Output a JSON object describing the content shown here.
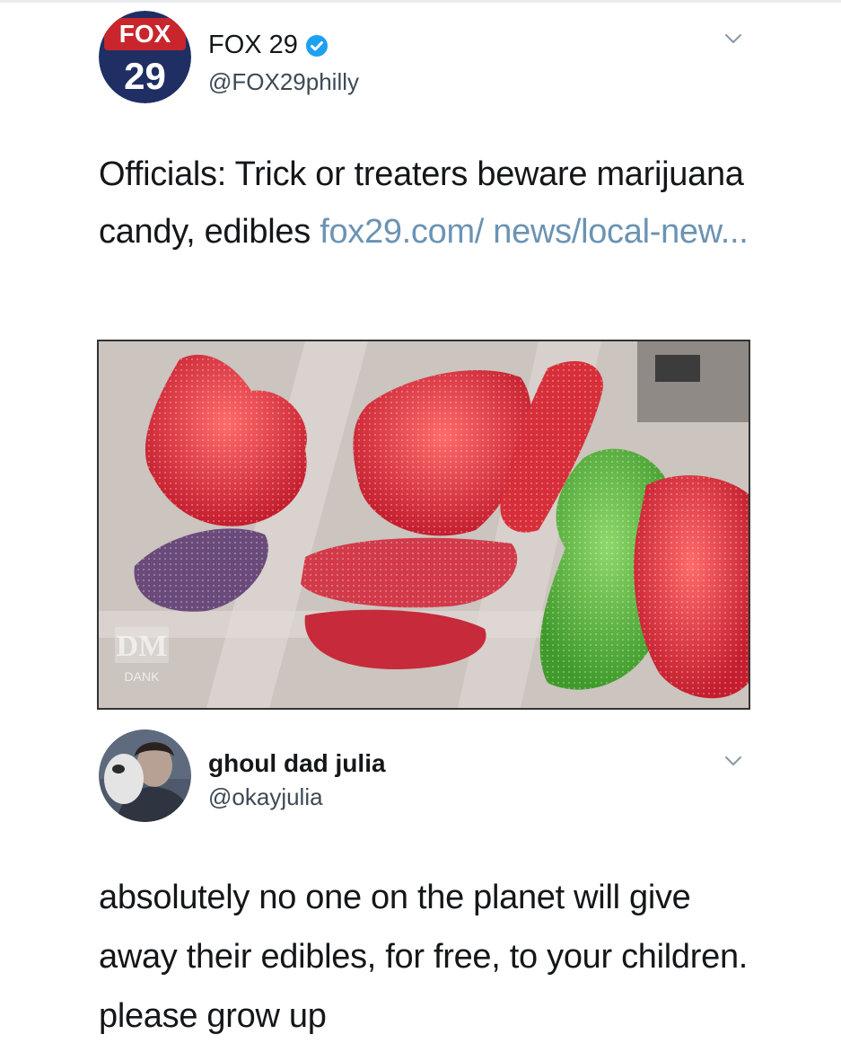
{
  "tweet1": {
    "display_name": "FOX 29",
    "handle": "@FOX29philly",
    "avatar_text": {
      "top": "FOX",
      "bottom": "29"
    },
    "text": "Officials: Trick or treaters beware marijuana candy, edibles ",
    "link": "fox29.com/ news/local-new...",
    "watermark": "DANK"
  },
  "tweet2": {
    "display_name": "ghoul dad julia",
    "handle": "@okayjulia",
    "text": "absolutely no one on the planet will give away their edibles, for free, to your children. please grow up"
  },
  "colors": {
    "link": "#6b93b3",
    "verified": "#1da1f2",
    "fox_navy": "#1f2f63",
    "fox_red": "#c8252c"
  }
}
